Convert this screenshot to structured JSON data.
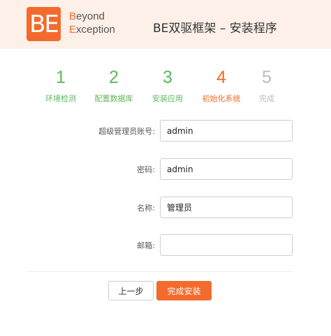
{
  "header": {
    "logo_text": "BE",
    "brand_line1_accent": "B",
    "brand_line1_rest": "eyond",
    "brand_line2_accent": "E",
    "brand_line2_rest": "xception",
    "title": "BE双驱框架 – 安装程序",
    "background": "#fdf0e8",
    "accent_color": "#f26b2d"
  },
  "steps": [
    {
      "number": "1",
      "label": "环境检测",
      "state": "done"
    },
    {
      "number": "2",
      "label": "配置数据库",
      "state": "done"
    },
    {
      "number": "3",
      "label": "安装应用",
      "state": "done"
    },
    {
      "number": "4",
      "label": "初始化系统",
      "state": "active"
    },
    {
      "number": "5",
      "label": "完成",
      "state": "pending"
    }
  ],
  "form": {
    "admin_account": {
      "label": "超级管理员账号:",
      "value": "admin"
    },
    "password": {
      "label": "密码:",
      "value": "admin"
    },
    "name": {
      "label": "名称:",
      "value": "管理员"
    },
    "email": {
      "label": "邮箱:",
      "value": ""
    }
  },
  "buttons": {
    "prev_label": "上一步",
    "finish_label": "完成安装"
  },
  "colors": {
    "done": "#5cb85c",
    "active": "#f26b2d",
    "pending": "#bbbbbb"
  }
}
